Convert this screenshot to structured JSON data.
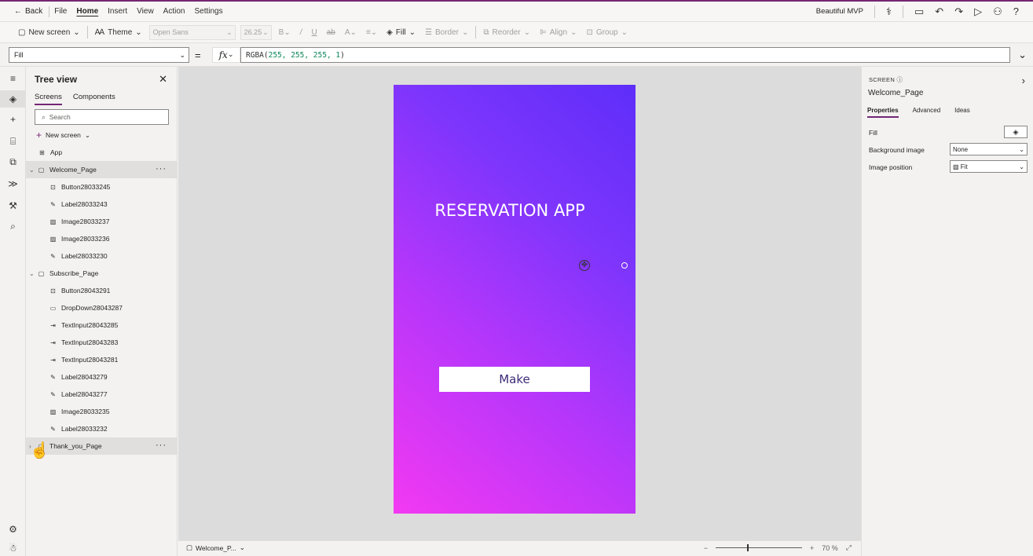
{
  "menubar": {
    "back_label": "Back",
    "items": [
      "File",
      "Home",
      "Insert",
      "View",
      "Action",
      "Settings"
    ],
    "active": "Home",
    "app_name": "Beautiful MVP"
  },
  "ribbon": {
    "new_screen": "New screen",
    "theme": "Theme",
    "font": "Open Sans",
    "font_size": "26.25",
    "fill": "Fill",
    "border": "Border",
    "reorder": "Reorder",
    "align": "Align",
    "group": "Group"
  },
  "formula": {
    "property": "Fill",
    "equals": "=",
    "fx": "fx",
    "func": "RGBA(",
    "args": "255, 255, 255, 1",
    "close": ")"
  },
  "tree": {
    "title": "Tree view",
    "tabs": [
      "Screens",
      "Components"
    ],
    "search_placeholder": "Search",
    "new_screen": "New screen",
    "app": "App",
    "screens": [
      {
        "name": "Welcome_Page",
        "selected": true,
        "children": [
          {
            "name": "Button28033245",
            "icon": "button-icon"
          },
          {
            "name": "Label28033243",
            "icon": "label-icon"
          },
          {
            "name": "Image28033237",
            "icon": "image-icon"
          },
          {
            "name": "Image28033236",
            "icon": "image-icon"
          },
          {
            "name": "Label28033230",
            "icon": "label-icon"
          }
        ]
      },
      {
        "name": "Subscribe_Page",
        "selected": false,
        "children": [
          {
            "name": "Button28043291",
            "icon": "button-icon"
          },
          {
            "name": "DropDown28043287",
            "icon": "dropdown-icon"
          },
          {
            "name": "TextInput28043285",
            "icon": "textinput-icon"
          },
          {
            "name": "TextInput28043283",
            "icon": "textinput-icon"
          },
          {
            "name": "TextInput28043281",
            "icon": "textinput-icon"
          },
          {
            "name": "Label28043279",
            "icon": "label-icon"
          },
          {
            "name": "Label28043277",
            "icon": "label-icon"
          },
          {
            "name": "Image28033235",
            "icon": "image-icon"
          },
          {
            "name": "Label28033232",
            "icon": "label-icon"
          }
        ]
      },
      {
        "name": "Thank_you_Page",
        "selected": false,
        "children": []
      }
    ]
  },
  "canvas": {
    "title": "RESERVATION APP",
    "button": "Make"
  },
  "status": {
    "screen": "Welcome_P...",
    "zoom": "70",
    "zoom_unit": "%"
  },
  "props": {
    "type_label": "SCREEN",
    "screen_name": "Welcome_Page",
    "tabs": [
      "Properties",
      "Advanced",
      "Ideas"
    ],
    "fill_label": "Fill",
    "bg_image_label": "Background image",
    "bg_image_value": "None",
    "img_pos_label": "Image position",
    "img_pos_value": "Fit"
  }
}
